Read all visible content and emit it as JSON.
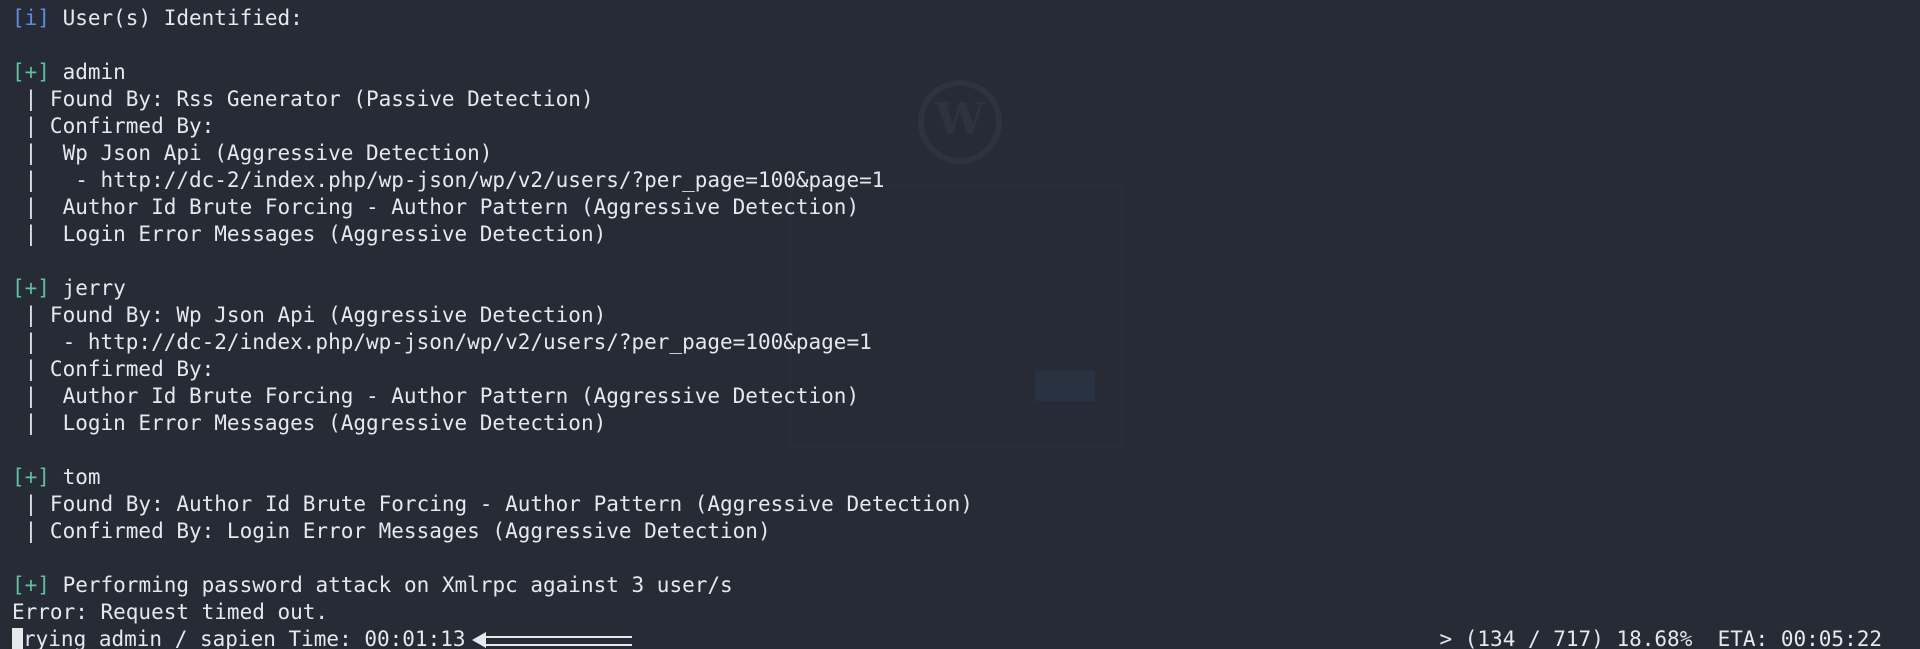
{
  "terminal": {
    "lines": [
      {
        "tag": "[i]",
        "text": " User(s) Identified:"
      },
      {
        "tag": "",
        "text": ""
      },
      {
        "tag": "[+]",
        "text": " admin"
      },
      {
        "tag": "",
        "text": " | Found By: Rss Generator (Passive Detection)"
      },
      {
        "tag": "",
        "text": " | Confirmed By:"
      },
      {
        "tag": "",
        "text": " |  Wp Json Api (Aggressive Detection)"
      },
      {
        "tag": "",
        "text": " |   - http://dc-2/index.php/wp-json/wp/v2/users/?per_page=100&page=1"
      },
      {
        "tag": "",
        "text": " |  Author Id Brute Forcing - Author Pattern (Aggressive Detection)"
      },
      {
        "tag": "",
        "text": " |  Login Error Messages (Aggressive Detection)"
      },
      {
        "tag": "",
        "text": ""
      },
      {
        "tag": "[+]",
        "text": " jerry"
      },
      {
        "tag": "",
        "text": " | Found By: Wp Json Api (Aggressive Detection)"
      },
      {
        "tag": "",
        "text": " |  - http://dc-2/index.php/wp-json/wp/v2/users/?per_page=100&page=1"
      },
      {
        "tag": "",
        "text": " | Confirmed By:"
      },
      {
        "tag": "",
        "text": " |  Author Id Brute Forcing - Author Pattern (Aggressive Detection)"
      },
      {
        "tag": "",
        "text": " |  Login Error Messages (Aggressive Detection)"
      },
      {
        "tag": "",
        "text": ""
      },
      {
        "tag": "[+]",
        "text": " tom"
      },
      {
        "tag": "",
        "text": " | Found By: Author Id Brute Forcing - Author Pattern (Aggressive Detection)"
      },
      {
        "tag": "",
        "text": " | Confirmed By: Login Error Messages (Aggressive Detection)"
      },
      {
        "tag": "",
        "text": ""
      },
      {
        "tag": "[+]",
        "text": " Performing password attack on Xmlrpc against 3 user/s"
      },
      {
        "tag": "",
        "text": "Error: Request timed out."
      }
    ],
    "progress_line": {
      "cursor_char": "T",
      "text": "rying admin / sapien Time: 00:01:13",
      "right_text": "> (134 / 717) 18.68%  ETA: 00:05:22"
    }
  }
}
